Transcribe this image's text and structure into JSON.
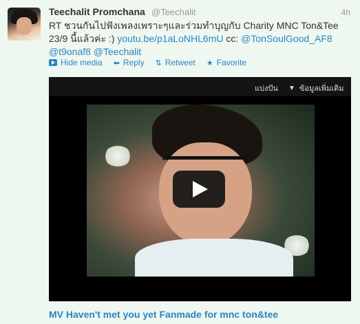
{
  "tweet": {
    "name": "Teechalit Promchana",
    "handle": "@Teechalit",
    "time": "4h",
    "text_prefix": "RT ชวนกันไปฟังเพลงเพราะๆและร่วมทำบุญกับ Charity MNC Ton&Tee 23/9 นี้แล้วค่ะ :) ",
    "link_url": "youtu.be/p1aLoNHL6mU",
    "text_cc": " cc: ",
    "mention_1": "@TonSoulGood_AF8",
    "mention_2": "@t9onaf8",
    "mention_3": "@Teechalit"
  },
  "actions": {
    "hide_media": "Hide media",
    "reply": "Reply",
    "retweet": "Retweet",
    "favorite": "Favorite"
  },
  "player": {
    "share_label": "แบ่งปัน",
    "info_label": "ข้อมูลเพิ่มเติม"
  },
  "video_title": "MV Haven't met you yet Fanmade for mnc ton&tee",
  "colors": {
    "link": "#2a85c3",
    "background": "#eef7f0"
  }
}
